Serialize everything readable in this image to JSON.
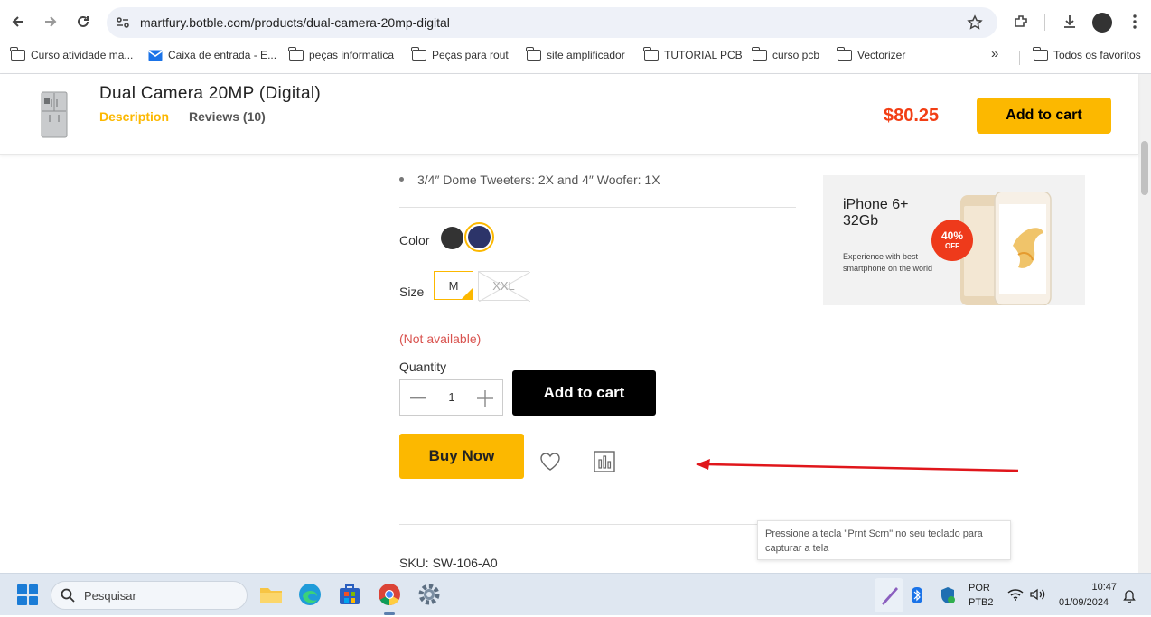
{
  "browser": {
    "url": "martfury.botble.com/products/dual-camera-20mp-digital",
    "bookmarks": [
      {
        "label": "Curso atividade ma...",
        "icon": "folder-icon"
      },
      {
        "label": "Caixa de entrada - E...",
        "icon": "gmail-icon"
      },
      {
        "label": "peças informatica",
        "icon": "folder-icon"
      },
      {
        "label": "Peças para rout",
        "icon": "folder-icon"
      },
      {
        "label": "site amplificador",
        "icon": "folder-icon"
      },
      {
        "label": "TUTORIAL PCB",
        "icon": "folder-icon"
      },
      {
        "label": "curso pcb",
        "icon": "folder-icon"
      },
      {
        "label": "Vectorizer",
        "icon": "folder-icon"
      }
    ],
    "more_bookmarks": "»",
    "all_bookmarks": "Todos os favoritos"
  },
  "sticky_header": {
    "title": "Dual Camera 20MP (Digital)",
    "tab_description": "Description",
    "tab_reviews": "Reviews (10)",
    "price": "$80.25",
    "add_to_cart": "Add to cart"
  },
  "product": {
    "spec_line": "3/4″ Dome Tweeters: 2X and 4″ Woofer: 1X",
    "color_label": "Color",
    "colors": [
      {
        "name": "black",
        "hex": "#333333",
        "selected": false
      },
      {
        "name": "navy",
        "hex": "#2c3469",
        "selected": true
      }
    ],
    "size_label": "Size",
    "sizes": [
      {
        "label": "M",
        "selected": true,
        "available": true
      },
      {
        "label": "XXL",
        "selected": false,
        "available": false
      }
    ],
    "availability": "(Not available)",
    "quantity_label": "Quantity",
    "quantity": "1",
    "add_to_cart": "Add to cart",
    "buy_now": "Buy Now",
    "sku": "SKU: SW-106-A0"
  },
  "promo": {
    "title": "iPhone 6+ 32Gb",
    "subtitle": "Experience with best smartphone on the world",
    "badge_percent": "40%",
    "badge_off": "OFF"
  },
  "tooltip": "Pressione a tecla \"Prnt Scrn\" no seu teclado para capturar a tela",
  "taskbar": {
    "search_placeholder": "Pesquisar",
    "lang_line1": "POR",
    "lang_line2": "PTB2",
    "time": "10:47",
    "date": "01/09/2024"
  },
  "colors": {
    "accent": "#fcb800",
    "price": "#f23e14",
    "error": "#d9534f",
    "annotation_arrow": "#e0161b"
  }
}
